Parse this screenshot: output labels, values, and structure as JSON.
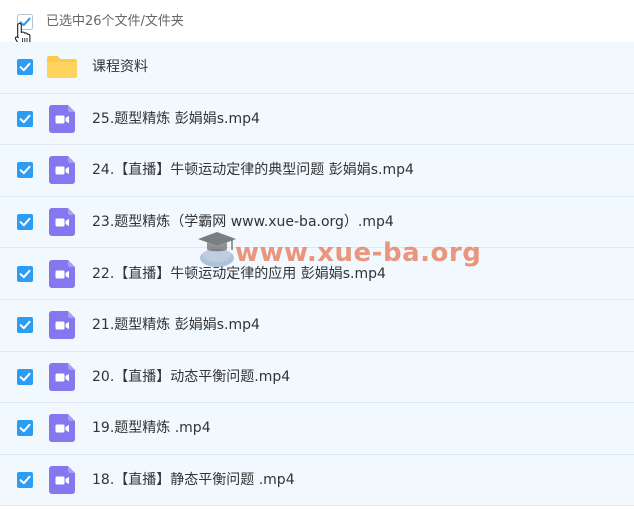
{
  "header": {
    "selection_text": "已选中26个文件/文件夹",
    "select_all_checked": true
  },
  "files": [
    {
      "name": "课程资料",
      "type": "folder",
      "checked": true
    },
    {
      "name": "25.题型精炼 彭娟娟s.mp4",
      "type": "video",
      "checked": true
    },
    {
      "name": "24.【直播】牛顿运动定律的典型问题 彭娟娟s.mp4",
      "type": "video",
      "checked": true
    },
    {
      "name": "23.题型精炼（学霸网 www.xue-ba.org）.mp4",
      "type": "video",
      "checked": true
    },
    {
      "name": "22.【直播】牛顿运动定律的应用 彭娟娟s.mp4",
      "type": "video",
      "checked": true
    },
    {
      "name": "21.题型精炼 彭娟娟s.mp4",
      "type": "video",
      "checked": true
    },
    {
      "name": "20.【直播】动态平衡问题.mp4",
      "type": "video",
      "checked": true
    },
    {
      "name": "19.题型精炼 .mp4",
      "type": "video",
      "checked": true
    },
    {
      "name": "18.【直播】静态平衡问题 .mp4",
      "type": "video",
      "checked": true
    }
  ],
  "watermark": {
    "text": "www.xue-ba.org"
  },
  "colors": {
    "checkbox": "#2c9df3",
    "row_background": "#f1f8fe",
    "video_icon": "#8477f0",
    "folder_icon": "#ffc94a",
    "watermark": "#e8785a"
  }
}
